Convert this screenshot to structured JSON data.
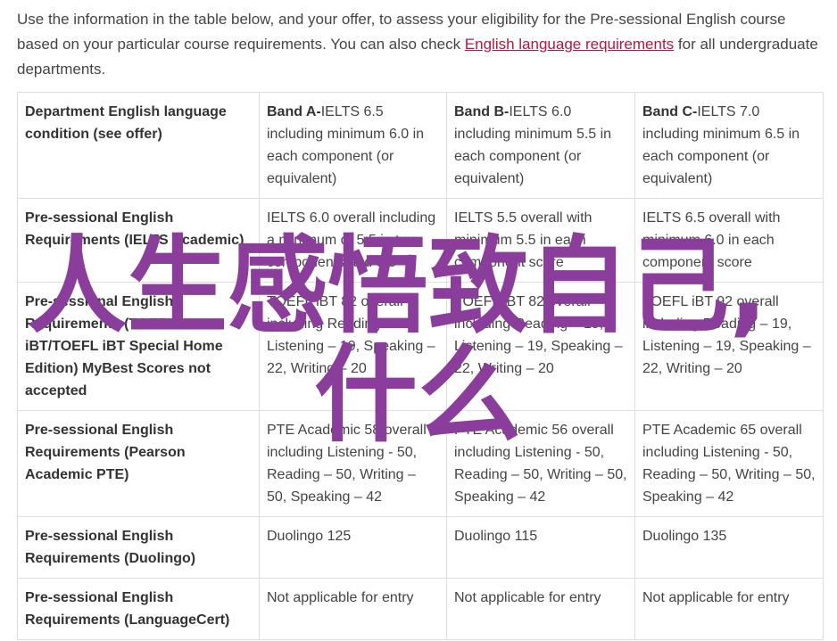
{
  "intro": {
    "text_before": "Use the information in the table below, and your offer, to assess your eligibility for the Pre-sessional English course based on your particular course requirements. You can also check ",
    "link_text": "English language requirements",
    "text_after": " for all undergraduate departments."
  },
  "table": {
    "header": {
      "label": "Department English language condition (see offer)",
      "bands": [
        {
          "name": "Band A-",
          "desc": "IELTS 6.5 including minimum 6.0 in each component (or equivalent)"
        },
        {
          "name": "Band B-",
          "desc": "IELTS 6.0 including minimum 5.5 in each component (or equivalent)"
        },
        {
          "name": "Band C-",
          "desc": "IELTS 7.0 including minimum 6.5 in each component (or equivalent)"
        }
      ]
    },
    "rows": [
      {
        "label": "Pre-sessional English Requirements (IELTS Academic)",
        "cells": [
          "IELTS 6.0 overall including a minimum of 5.5 in two components and 5.5",
          "IELTS 5.5 overall with minimum 5.5 in each component score",
          "IELTS 6.5 overall with minimum 6.0 in each component score"
        ]
      },
      {
        "label": "Pre-sessional English Requirements (TOEFL iBT/TOEFL iBT Special Home Edition) MyBest Scores not accepted",
        "cells": [
          "TOEFL iBT 82 overall including Reading – 19, Listening – 19, Speaking – 22, Writing – 20",
          "TOEFL iBT 82 overall including Reading – 19, Listening – 19, Speaking – 22, Writing – 20",
          "TOEFL iBT 92 overall including Reading – 19, Listening – 19, Speaking – 22, Writing – 20"
        ]
      },
      {
        "label": "Pre-sessional English Requirements (Pearson Academic PTE)",
        "cells": [
          "PTE Academic 58 overall including Listening - 50, Reading – 50, Writing – 50, Speaking – 42",
          "PTE Academic 56 overall including Listening - 50, Reading – 50, Writing – 50, Speaking – 42",
          "PTE Academic 65 overall including Listening - 50, Reading – 50, Writing – 50, Speaking – 42"
        ]
      },
      {
        "label": "Pre-sessional English Requirements (Duolingo)",
        "cells": [
          "Duolingo 125",
          "Duolingo 115",
          "Duolingo 135"
        ]
      },
      {
        "label": "Pre-sessional English Requirements (LanguageCert)",
        "cells": [
          "Not applicable for entry",
          "Not applicable for entry",
          "Not applicable for entry"
        ]
      }
    ]
  },
  "watermark": {
    "line1": "人生感悟致自己,",
    "line2": "什么",
    "color": "#8a3d9a"
  }
}
